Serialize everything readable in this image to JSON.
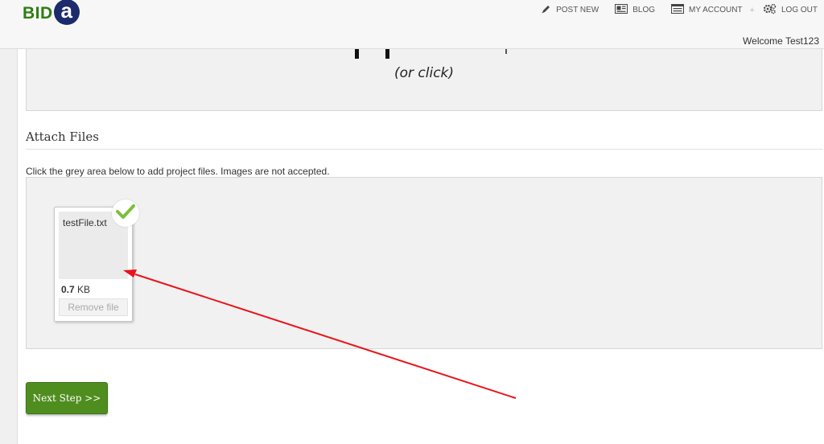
{
  "header": {
    "logo_text": "BID",
    "logo_mark": "a",
    "nav": [
      {
        "label": "POST NEW",
        "icon": "pencil-icon"
      },
      {
        "label": "BLOG",
        "icon": "newspaper-icon"
      },
      {
        "label": "MY ACCOUNT",
        "icon": "account-card-icon"
      },
      {
        "label": "LOG OUT",
        "icon": "gears-icon"
      }
    ],
    "nav_separator": "+",
    "welcome": "Welcome Test123"
  },
  "upload_area": {
    "hint": "(or click)"
  },
  "attach_section": {
    "title": "Attach Files",
    "instruction": "Click the grey area below to add project files. Images are not accepted."
  },
  "file": {
    "name": "testFile.txt",
    "size_value": "0.7",
    "size_unit": "KB",
    "remove_label": "Remove file",
    "status": "uploaded"
  },
  "next_button": {
    "label": "Next Step >>"
  },
  "colors": {
    "brand_green": "#4f8d1f",
    "logo_green": "#2e7d12",
    "logo_navy": "#1d2a6b",
    "check_green": "#7cbf3a",
    "annotation_red": "#e8141b"
  }
}
